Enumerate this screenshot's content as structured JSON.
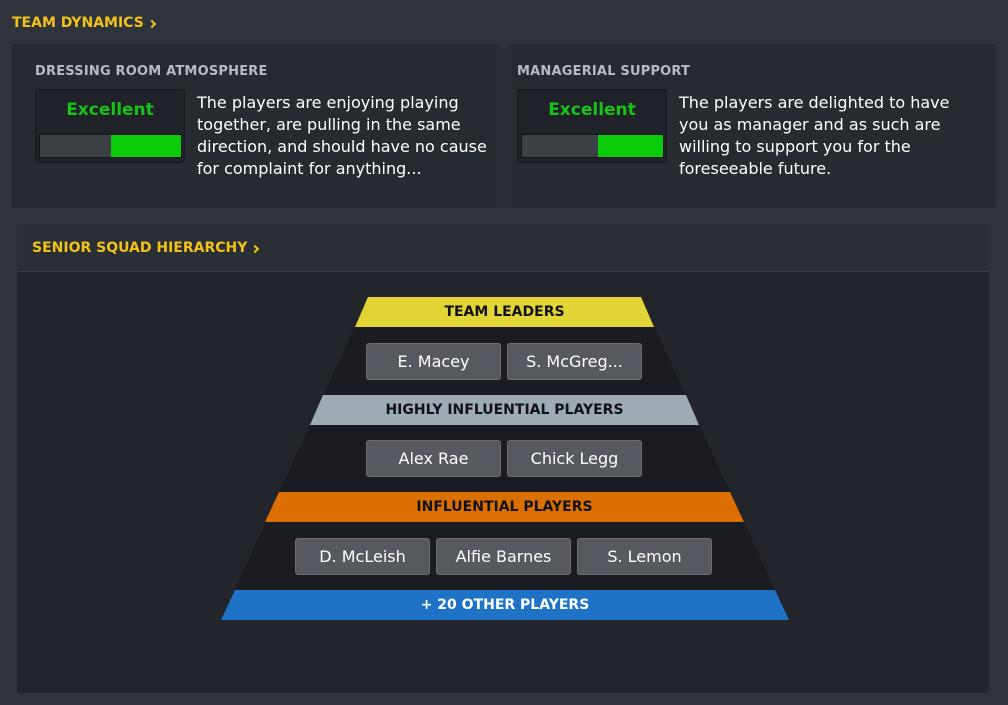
{
  "team_dynamics": {
    "title": "TEAM DYNAMICS",
    "dressing_room": {
      "label": "DRESSING ROOM ATMOSPHERE",
      "rating": "Excellent",
      "level": 0.5,
      "description": "The players are enjoying playing together, are pulling in the same direction, and should have no cause for complaint for anything..."
    },
    "managerial_support": {
      "label": "MANAGERIAL SUPPORT",
      "rating": "Excellent",
      "level": 0.46,
      "description": "The players are delighted to have you as manager and as such are willing to support you for the foreseeable future."
    }
  },
  "hierarchy": {
    "title": "SENIOR SQUAD HIERARCHY",
    "team_leaders": {
      "label": "TEAM LEADERS",
      "players": [
        "E. Macey",
        "S. McGreg..."
      ]
    },
    "highly_influential": {
      "label": "HIGHLY INFLUENTIAL PLAYERS",
      "players": [
        "Alex Rae",
        "Chick Legg"
      ]
    },
    "influential": {
      "label": "INFLUENTIAL PLAYERS",
      "players": [
        "D. McLeish",
        "Alfie Barnes",
        "S. Lemon"
      ]
    },
    "others": {
      "label": "+ 20 OTHER PLAYERS"
    }
  },
  "colors": {
    "accent": "#f2c21b",
    "rating_green": "#19c219",
    "team_leaders": "#e3d536",
    "highly_influential": "#9eabb3",
    "influential": "#dc6f02",
    "others": "#1e73c7"
  }
}
